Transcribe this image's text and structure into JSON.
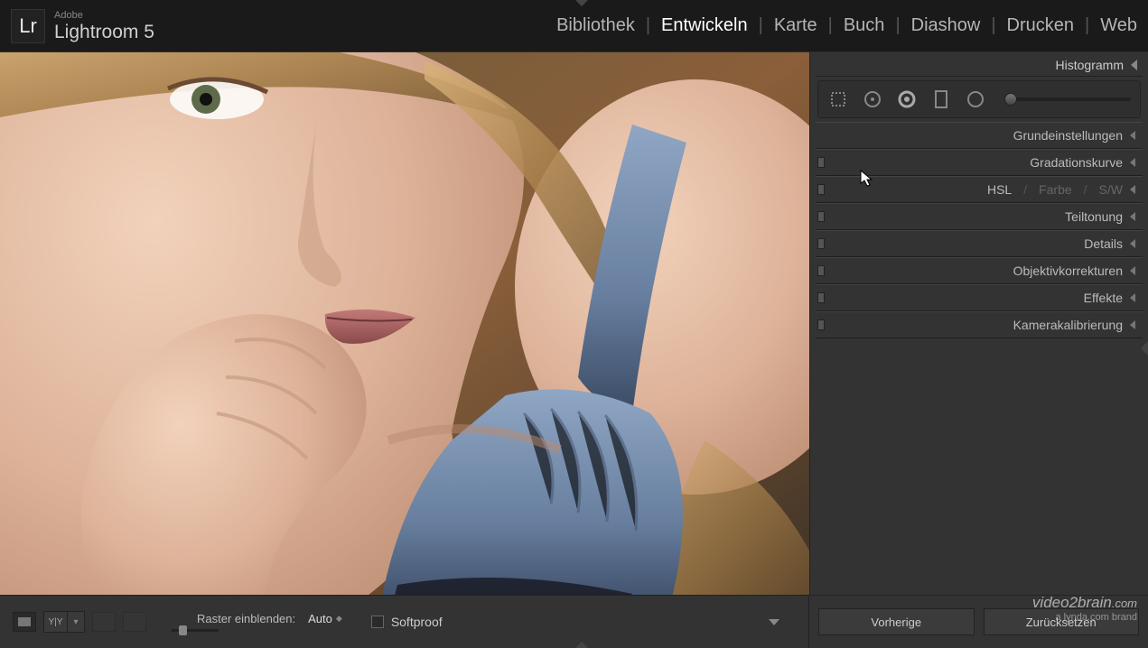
{
  "app": {
    "vendor": "Adobe",
    "name": "Lightroom 5",
    "logo": "Lr"
  },
  "modules": {
    "items": [
      "Bibliothek",
      "Entwickeln",
      "Karte",
      "Buch",
      "Diashow",
      "Drucken",
      "Web"
    ],
    "active": "Entwickeln"
  },
  "right_panel": {
    "histogram": "Histogramm",
    "tools": [
      "crop-tool",
      "spot-removal-tool",
      "redeye-tool",
      "graduated-filter-tool",
      "radial-filter-tool",
      "adjustment-brush-tool"
    ],
    "panels": [
      {
        "label": "Grundeinstellungen",
        "switch": false
      },
      {
        "label": "Gradationskurve",
        "switch": true
      },
      {
        "multi": [
          "HSL",
          "Farbe",
          "S/W"
        ],
        "switch": true
      },
      {
        "label": "Teiltonung",
        "switch": true
      },
      {
        "label": "Details",
        "switch": true
      },
      {
        "label": "Objektivkorrekturen",
        "switch": true
      },
      {
        "label": "Effekte",
        "switch": true
      },
      {
        "label": "Kamerakalibrierung",
        "switch": true
      }
    ]
  },
  "toolbar": {
    "raster_label": "Raster einblenden:",
    "raster_value": "Auto",
    "softproof": "Softproof"
  },
  "buttons": {
    "previous": "Vorherige",
    "reset": "Zurücksetzen"
  },
  "watermark": {
    "brand": "video2brain",
    "tld": ".com",
    "tagline": "a lynda.com brand"
  }
}
